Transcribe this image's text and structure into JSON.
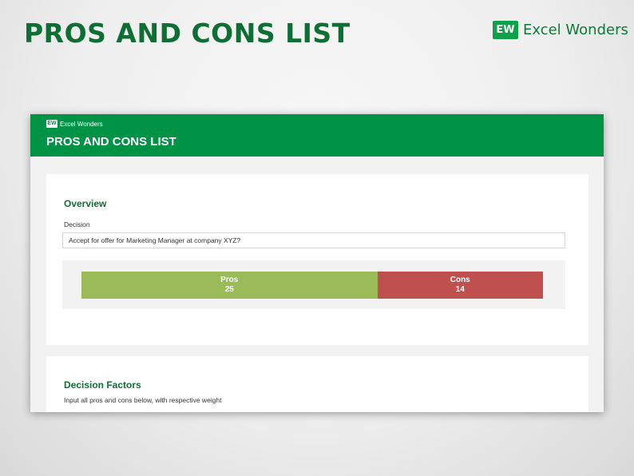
{
  "page": {
    "title": "PROS AND CONS LIST",
    "brand_logo": "EW",
    "brand_name": "Excel Wonders"
  },
  "sheet": {
    "brand_logo": "EW",
    "brand_name": "Excel Wonders",
    "title": "PROS AND CONS LIST"
  },
  "overview": {
    "heading": "Overview",
    "decision_label": "Decision",
    "decision_value": "Accept for offer for Marketing Manager at company XYZ?",
    "pros": {
      "label": "Pros",
      "value": 25,
      "color": "#9bbb59"
    },
    "cons": {
      "label": "Cons",
      "value": 14,
      "color": "#c0504d"
    }
  },
  "factors": {
    "heading": "Decision Factors",
    "subtitle": "Input all pros and cons below, with respective weight"
  },
  "colors": {
    "header_green": "#009245",
    "title_green": "#0e6e33"
  }
}
